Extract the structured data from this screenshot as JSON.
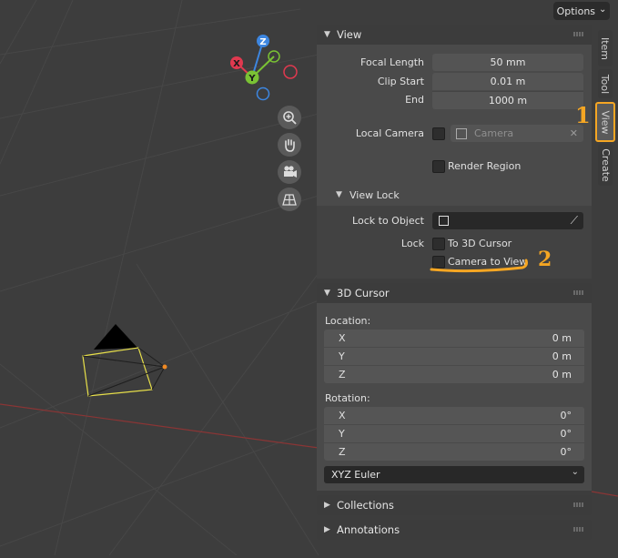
{
  "header": {
    "options_label": "Options",
    "options_arrow": "⌄"
  },
  "gizmo": {
    "z": "Z",
    "x": "X",
    "y": "Y"
  },
  "nav_icons": [
    "zoom-icon",
    "pan-hand-icon",
    "camera-view-icon",
    "perspective-grid-icon"
  ],
  "tabs": [
    "Item",
    "Tool",
    "View",
    "Create"
  ],
  "view_panel": {
    "title": "View",
    "focal_length_label": "Focal Length",
    "focal_length_value": "50 mm",
    "clip_start_label": "Clip Start",
    "clip_start_value": "0.01 m",
    "end_label": "End",
    "end_value": "1000 m",
    "local_camera_label": "Local Camera",
    "local_camera_placeholder": "Camera",
    "render_region_label": "Render Region",
    "view_lock_title": "View Lock",
    "lock_to_object_label": "Lock to Object",
    "lock_label": "Lock",
    "to_3d_cursor_label": "To 3D Cursor",
    "camera_to_view_label": "Camera to View"
  },
  "cursor_panel": {
    "title": "3D Cursor",
    "location_label": "Location:",
    "location": [
      {
        "axis": "X",
        "value": "0 m"
      },
      {
        "axis": "Y",
        "value": "0 m"
      },
      {
        "axis": "Z",
        "value": "0 m"
      }
    ],
    "rotation_label": "Rotation:",
    "rotation": [
      {
        "axis": "X",
        "value": "0°"
      },
      {
        "axis": "Y",
        "value": "0°"
      },
      {
        "axis": "Z",
        "value": "0°"
      }
    ],
    "rotation_mode": "XYZ Euler"
  },
  "collapsed_panels": {
    "collections": "Collections",
    "annotations": "Annotations"
  },
  "annotations": {
    "step1": "1",
    "step2": "2"
  },
  "colors": {
    "accent_orange": "#f5a623",
    "axis_x": "#e0394f",
    "axis_y": "#7ac234",
    "axis_z": "#3d86e0"
  }
}
